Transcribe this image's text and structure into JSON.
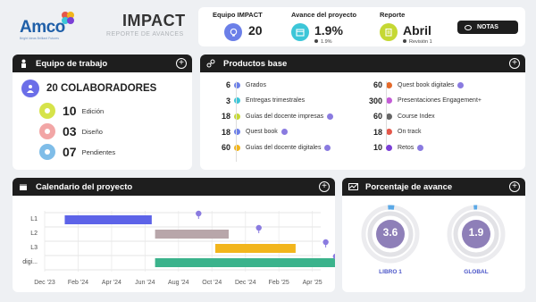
{
  "brand": {
    "logo": "Amco",
    "tagline": "Bright Ideas Brilliant Futures"
  },
  "header": {
    "title": "IMPACT",
    "subtitle": "REPORTE DE AVANCES"
  },
  "kpis": [
    {
      "label": "Equipo IMPACT",
      "value": "20",
      "sub": "",
      "icon": "lightbulb-icon",
      "color": "#6b7fe8"
    },
    {
      "label": "Avance del proyecto",
      "value": "1.9%",
      "sub": "1.9%",
      "icon": "calendar-icon",
      "color": "#3cc6d8"
    },
    {
      "label": "Reporte",
      "value": "Abril",
      "sub": "Revisión 1",
      "icon": "clipboard-icon",
      "color": "#c5d834"
    }
  ],
  "notes_button": "NOTAS",
  "team": {
    "title": "Equipo de trabajo",
    "total": "20 COLABORADORES",
    "rows": [
      {
        "value": "10",
        "label": "Edición",
        "color": "#d6e34a"
      },
      {
        "value": "03",
        "label": "Diseño",
        "color": "#f2a6a6"
      },
      {
        "value": "07",
        "label": "Pendientes",
        "color": "#7fbde8"
      }
    ]
  },
  "products": {
    "title": "Productos base",
    "left": [
      {
        "value": "6",
        "label": "Grados",
        "color": "#6b7fe8",
        "pin": false
      },
      {
        "value": "3",
        "label": "Entregas trimestrales",
        "color": "#3cc6d8",
        "pin": false
      },
      {
        "value": "18",
        "label": "Guías del docente impresas",
        "color": "#c5d834",
        "pin": true
      },
      {
        "value": "18",
        "label": "Quest book",
        "color": "#6b7fe8",
        "pin": true
      },
      {
        "value": "60",
        "label": "Guías del docente digitales",
        "color": "#f2b51c",
        "pin": true
      }
    ],
    "right": [
      {
        "value": "60",
        "label": "Quest book digitales",
        "color": "#e46a2a",
        "pin": true
      },
      {
        "value": "300",
        "label": "Presentaciones Engagement+",
        "color": "#c35bd6",
        "pin": false
      },
      {
        "value": "60",
        "label": "Course Index",
        "color": "#666666",
        "pin": false
      },
      {
        "value": "18",
        "label": "On track",
        "color": "#e4574a",
        "pin": false
      },
      {
        "value": "10",
        "label": "Retos",
        "color": "#7b3fd6",
        "pin": true
      }
    ]
  },
  "calendar": {
    "title": "Calendario del proyecto",
    "rows": [
      "L1",
      "L2",
      "L3",
      "digi..."
    ],
    "ticks": [
      "Dec '23",
      "Feb '24",
      "Apr '24",
      "Jun '24",
      "Aug '24",
      "Oct '24",
      "Dec '24",
      "Feb '25",
      "Apr '25"
    ],
    "bars": [
      {
        "row": "L1",
        "start": 1.6,
        "end": 4.2,
        "color": "#5d63e8"
      },
      {
        "row": "L2",
        "start": 4.3,
        "end": 6.5,
        "color": "#b8a6aa"
      },
      {
        "row": "L3",
        "start": 6.1,
        "end": 8.5,
        "color": "#f2b51c"
      },
      {
        "row": "digi...",
        "start": 4.3,
        "end": 9.8,
        "color": "#3bb38c"
      }
    ],
    "milestones": [
      {
        "row": "L1",
        "at": 5.6
      },
      {
        "row": "L2",
        "at": 7.4
      },
      {
        "row": "L3",
        "at": 9.4
      },
      {
        "row": "digi...",
        "at": 9.7
      }
    ]
  },
  "progress": {
    "title": "Porcentaje de avance",
    "gauges": [
      {
        "value": "3.6",
        "label": "LIBRO 1",
        "fraction": 0.036
      },
      {
        "value": "1.9",
        "label": "GLOBAL",
        "fraction": 0.019
      }
    ]
  }
}
